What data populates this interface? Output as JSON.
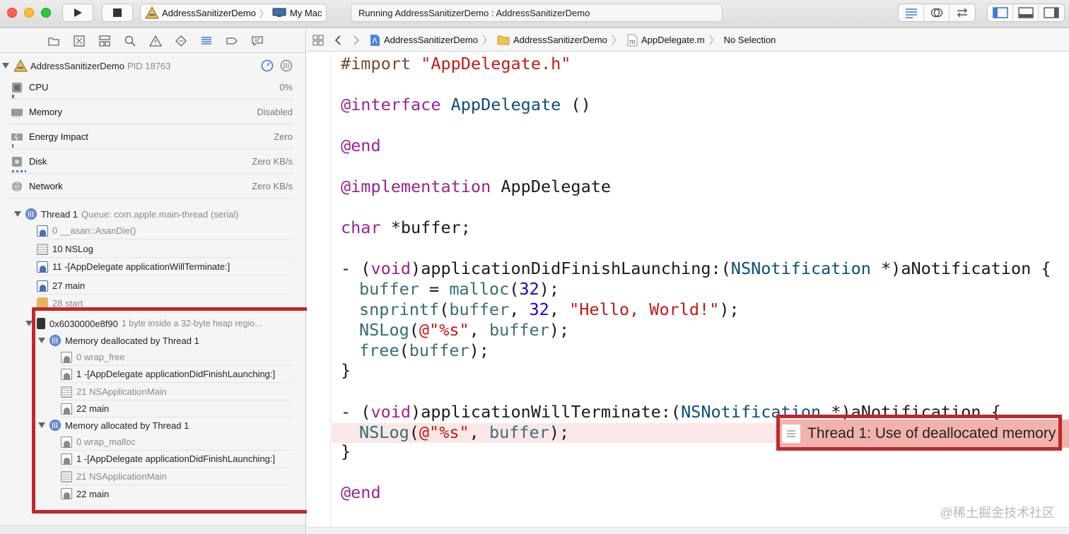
{
  "toolbar": {
    "scheme_target": "AddressSanitizerDemo",
    "scheme_device": "My Mac",
    "activity": "Running AddressSanitizerDemo : AddressSanitizerDemo"
  },
  "process": {
    "name": "AddressSanitizerDemo",
    "pid_text": "PID 18763"
  },
  "gauges": [
    {
      "label": "CPU",
      "value": "0%"
    },
    {
      "label": "Memory",
      "value": "Disabled"
    },
    {
      "label": "Energy Impact",
      "value": "Zero"
    },
    {
      "label": "Disk",
      "value": "Zero KB/s"
    },
    {
      "label": "Network",
      "value": "Zero KB/s"
    }
  ],
  "thread": {
    "name": "Thread 1",
    "queue": "Queue: com.apple.main-thread (serial)",
    "frames": [
      {
        "text": "0 __asan::AsanDie()"
      },
      {
        "text": "10 NSLog"
      },
      {
        "text": "11 -[AppDelegate applicationWillTerminate:]"
      },
      {
        "text": "27 main"
      },
      {
        "text": "28 start"
      }
    ]
  },
  "memory": {
    "address": "0x6030000e8f90",
    "description": "1 byte inside a 32-byte heap regio...",
    "deallocated_title": "Memory deallocated by Thread 1",
    "deallocated_frames": [
      {
        "text": "0 wrap_free"
      },
      {
        "text": "1 -[AppDelegate applicationDidFinishLaunching:]"
      },
      {
        "text": "21 NSApplicationMain"
      },
      {
        "text": "22 main"
      }
    ],
    "allocated_title": "Memory allocated by Thread 1",
    "allocated_frames": [
      {
        "text": "0 wrap_malloc"
      },
      {
        "text": "1 -[AppDelegate applicationDidFinishLaunching:]"
      },
      {
        "text": "21 NSApplicationMain"
      },
      {
        "text": "22 main"
      }
    ]
  },
  "jumpbar": {
    "project": "AddressSanitizerDemo",
    "group": "AddressSanitizerDemo",
    "file": "AppDelegate.m",
    "selection": "No Selection"
  },
  "editor": {
    "error_message": "Thread 1: Use of deallocated memory",
    "watermark": "@稀土掘金技术社区",
    "code": {
      "l1_kw": "#import",
      "l1_str": "\"AppDelegate.h\"",
      "l2_kw": "@interface",
      "l2_cls": "AppDelegate",
      "l2_rest": " ()",
      "l3_kw": "@end",
      "l4_kw": "@implementation",
      "l4_rest": " AppDelegate",
      "l5_kw": "char",
      "l5_rest": " *buffer;",
      "l6_a": "- (",
      "l6_void": "void",
      "l6_b": ")applicationDidFinishLaunching:(",
      "l6_cls": "NSNotification",
      "l6_c": " *)aNotification {",
      "l7_var": "buffer",
      "l7_a": " = ",
      "l7_fn": "malloc",
      "l7_b": "(",
      "l7_num": "32",
      "l7_c": ");",
      "l8_fn": "snprintf",
      "l8_a": "(",
      "l8_var": "buffer",
      "l8_b": ", ",
      "l8_num": "32",
      "l8_c": ", ",
      "l8_str": "\"Hello, World!\"",
      "l8_d": ");",
      "l9_fn": "NSLog",
      "l9_a": "(",
      "l9_str": "@\"%s\"",
      "l9_b": ", ",
      "l9_var": "buffer",
      "l9_c": ");",
      "l10_fn": "free",
      "l10_a": "(",
      "l10_var": "buffer",
      "l10_b": ");",
      "l11": "}",
      "l12_a": "- (",
      "l12_void": "void",
      "l12_b": ")applicationWillTerminate:(",
      "l12_cls": "NSNotification",
      "l12_c": " *)aNotification {",
      "l13_fn": "NSLog",
      "l13_a": "(",
      "l13_str": "@\"%s\"",
      "l13_b": ", ",
      "l13_var": "buffer",
      "l13_c": ");",
      "l14": "}",
      "l15_kw": "@end"
    }
  },
  "colors": {
    "highlight_border": "#c1272d",
    "error_badge": "#f3b3ad",
    "error_line": "#fbe7e6",
    "keyword": "#9b2393",
    "string": "#c41a16",
    "number": "#1c00cf"
  }
}
